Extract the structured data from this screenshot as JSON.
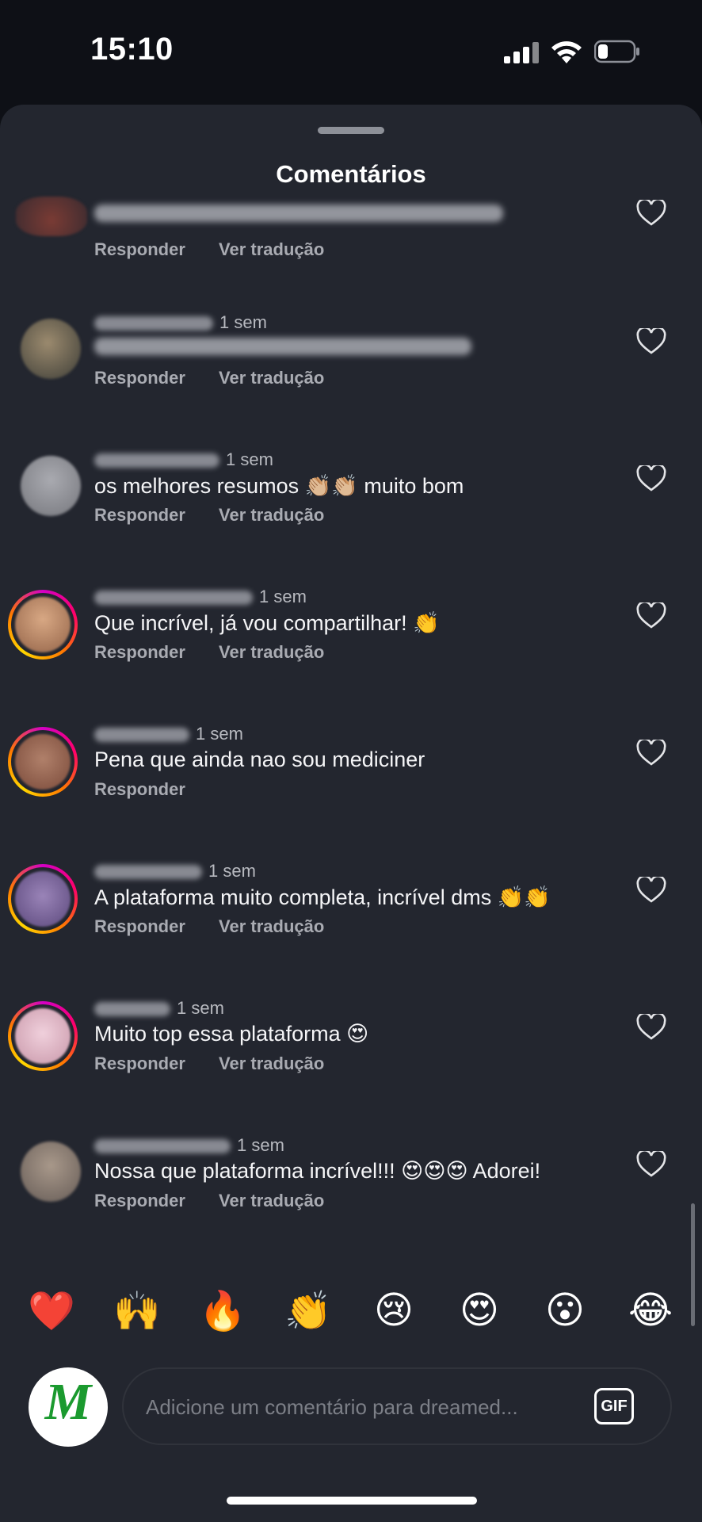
{
  "status_bar": {
    "time": "15:10"
  },
  "sheet": {
    "title": "Comentários"
  },
  "comments": [
    {
      "time": "",
      "text": "",
      "reply": "Responder",
      "translate": "Ver tradução"
    },
    {
      "time": "1 sem",
      "text": "",
      "reply": "Responder",
      "translate": "Ver tradução"
    },
    {
      "time": "1 sem",
      "text": "os melhores resumos 👏🏼👏🏼 muito bom",
      "reply": "Responder",
      "translate": "Ver tradução"
    },
    {
      "time": "1 sem",
      "text": "Que incrível, já vou compartilhar! 👏",
      "reply": "Responder",
      "translate": "Ver tradução"
    },
    {
      "time": "1 sem",
      "text": "Pena que ainda nao sou mediciner",
      "reply": "Responder",
      "translate": ""
    },
    {
      "time": "1 sem",
      "text": "A plataforma muito completa, incrível dms 👏👏",
      "reply": "Responder",
      "translate": "Ver tradução"
    },
    {
      "time": "1 sem",
      "text": "Muito top essa plataforma 😍",
      "reply": "Responder",
      "translate": "Ver tradução"
    },
    {
      "time": "1 sem",
      "text": "Nossa que plataforma incrível!!! 😍😍😍 Adorei!",
      "reply": "Responder",
      "translate": "Ver tradução"
    }
  ],
  "emoji_bar": [
    "❤️",
    "🙌",
    "🔥",
    "👏",
    "😢",
    "😍",
    "😮",
    "😂"
  ],
  "composer": {
    "avatar_letter": "M",
    "placeholder": "Adicione um comentário para dreamed...",
    "gif_label": "GIF"
  },
  "colors": {
    "sheet_bg": "#23262f",
    "page_bg": "#0e1016",
    "brand_green": "#1b9a2f"
  }
}
